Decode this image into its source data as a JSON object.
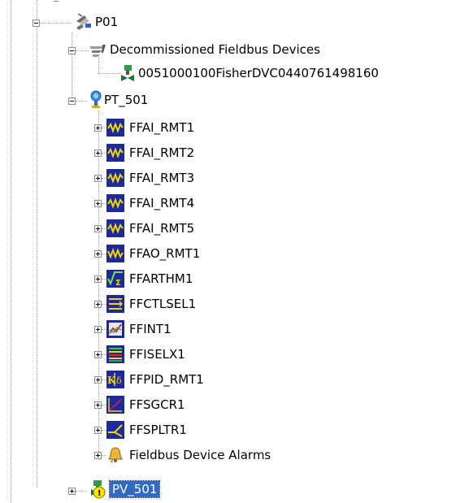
{
  "tree": {
    "root": {
      "label": "P01",
      "icon": "plant-area-icon"
    },
    "decommissioned": {
      "label": "Decommissioned Fieldbus Devices",
      "icon": "decommissioned-devices-icon",
      "device": {
        "label": "0051000100FisherDVC0440761498160",
        "icon": "fieldbus-valve-device-icon"
      }
    },
    "pt501": {
      "label": "PT_501",
      "icon": "pressure-transmitter-icon",
      "blocks": [
        {
          "label": "FFAI_RMT1",
          "icon": "analog-input-block-icon"
        },
        {
          "label": "FFAI_RMT2",
          "icon": "analog-input-block-icon"
        },
        {
          "label": "FFAI_RMT3",
          "icon": "analog-input-block-icon"
        },
        {
          "label": "FFAI_RMT4",
          "icon": "analog-input-block-icon"
        },
        {
          "label": "FFAI_RMT5",
          "icon": "analog-input-block-icon"
        },
        {
          "label": "FFAO_RMT1",
          "icon": "analog-output-block-icon"
        },
        {
          "label": "FFARTHM1",
          "icon": "arithmetic-block-icon"
        },
        {
          "label": "FFCTLSEL1",
          "icon": "control-selector-block-icon"
        },
        {
          "label": "FFINT1",
          "icon": "integrator-block-icon"
        },
        {
          "label": "FFISELX1",
          "icon": "input-selector-block-icon"
        },
        {
          "label": "FFPID_RMT1",
          "icon": "pid-block-icon"
        },
        {
          "label": "FFSGCR1",
          "icon": "signal-characterizer-block-icon"
        },
        {
          "label": "FFSPLTR1",
          "icon": "splitter-block-icon"
        },
        {
          "label": "Fieldbus Device Alarms",
          "icon": "device-alarms-icon"
        }
      ]
    },
    "pv501": {
      "label": "PV_501",
      "icon": "valve-device-warning-icon",
      "selected": true
    }
  }
}
